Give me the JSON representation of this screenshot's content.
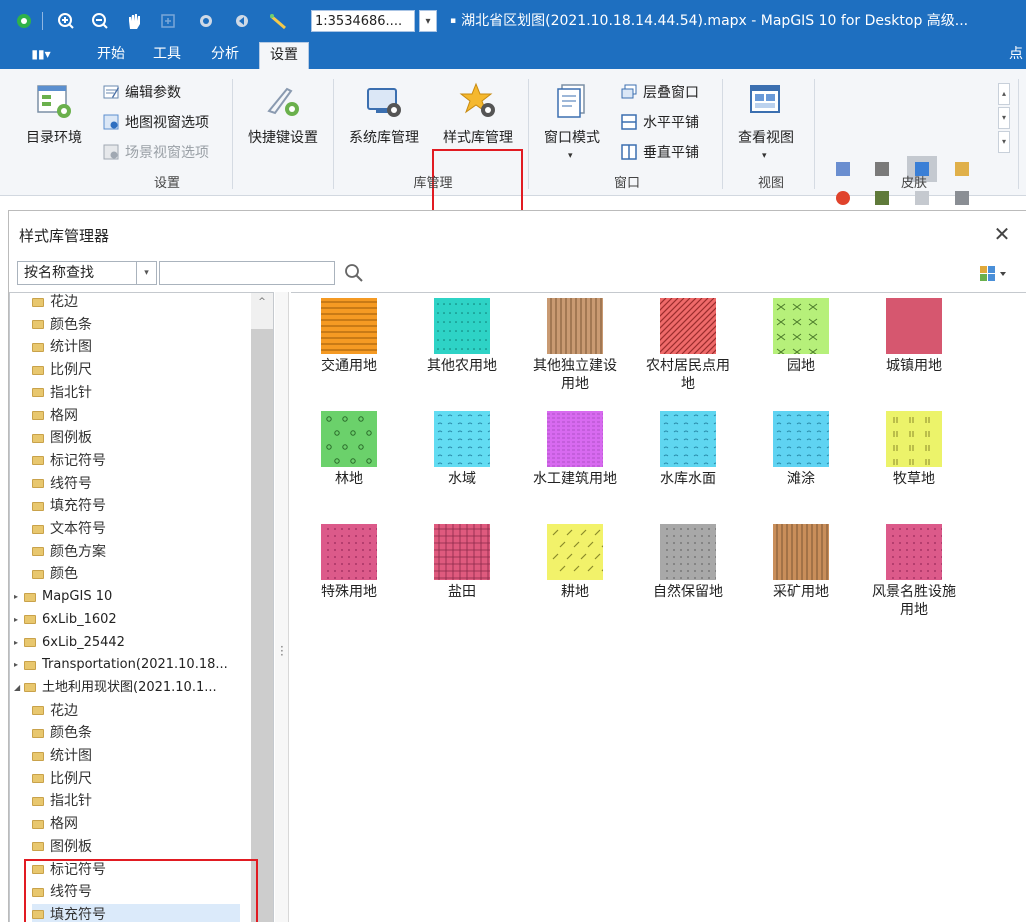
{
  "toolbar": {
    "scale_value": "1:3534686....",
    "window_title": "湖北省区划图(2021.10.18.14.44.54).mapx - MapGIS 10 for Desktop 高级..."
  },
  "tabs": [
    {
      "label": "开始"
    },
    {
      "label": "工具"
    },
    {
      "label": "分析"
    },
    {
      "label": "设置",
      "active": true
    },
    {
      "label": "点"
    }
  ],
  "ribbon": {
    "settings_group": {
      "label": "设置",
      "catalog_env": "目录环境",
      "edit_params": "编辑参数",
      "map_view_options": "地图视窗选项",
      "scene_view_options": "场景视窗选项",
      "shortcut_settings": "快捷键设置"
    },
    "library_group": {
      "label": "库管理",
      "system_lib": "系统库管理",
      "style_lib": "样式库管理"
    },
    "window_group": {
      "label": "窗口",
      "window_mode": "窗口模式",
      "cascade": "层叠窗口",
      "tile_horizontal": "水平平铺",
      "tile_vertical": "垂直平铺"
    },
    "view_group": {
      "label": "视图",
      "view_button": "查看视图"
    },
    "skin_group": {
      "label": "皮肤"
    }
  },
  "dialog": {
    "title": "样式库管理器",
    "search_mode": "按名称查找",
    "search_placeholder": ""
  },
  "tree": [
    {
      "label": "花边",
      "kind": "folder"
    },
    {
      "label": "颜色条",
      "kind": "folder"
    },
    {
      "label": "统计图",
      "kind": "folder"
    },
    {
      "label": "比例尺",
      "kind": "folder"
    },
    {
      "label": "指北针",
      "kind": "folder"
    },
    {
      "label": "格网",
      "kind": "folder"
    },
    {
      "label": "图例板",
      "kind": "folder"
    },
    {
      "label": "标记符号",
      "kind": "folder"
    },
    {
      "label": "线符号",
      "kind": "folder"
    },
    {
      "label": "填充符号",
      "kind": "folder"
    },
    {
      "label": "文本符号",
      "kind": "folder"
    },
    {
      "label": "颜色方案",
      "kind": "folder"
    },
    {
      "label": "颜色",
      "kind": "folder"
    },
    {
      "label": "MapGIS 10",
      "kind": "root"
    },
    {
      "label": "6xLib_1602",
      "kind": "root"
    },
    {
      "label": "6xLib_25442",
      "kind": "root"
    },
    {
      "label": "Transportation(2021.10.18...",
      "kind": "root"
    },
    {
      "label": "土地利用现状图(2021.10.1...",
      "kind": "root-open"
    },
    {
      "label": "花边",
      "kind": "folder"
    },
    {
      "label": "颜色条",
      "kind": "folder"
    },
    {
      "label": "统计图",
      "kind": "folder"
    },
    {
      "label": "比例尺",
      "kind": "folder"
    },
    {
      "label": "指北针",
      "kind": "folder"
    },
    {
      "label": "格网",
      "kind": "folder"
    },
    {
      "label": "图例板",
      "kind": "folder"
    },
    {
      "label": "标记符号",
      "kind": "folder"
    },
    {
      "label": "线符号",
      "kind": "folder"
    },
    {
      "label": "填充符号",
      "kind": "folder",
      "selected": true
    }
  ],
  "symbols": [
    {
      "label": "交通用地",
      "pattern": "h-stripes",
      "color": "#f59a23",
      "line": "#9a5a08"
    },
    {
      "label": "其他农用地",
      "pattern": "dots",
      "color": "#2ed3c6",
      "line": "#0e7a72"
    },
    {
      "label": "其他独立建设用地",
      "pattern": "v-stripes",
      "color": "#c99a72",
      "line": "#7a5534"
    },
    {
      "label": "农村居民点用地",
      "pattern": "diag",
      "color": "#ef6a6a",
      "line": "#9a2d2d"
    },
    {
      "label": "园地",
      "pattern": "scissors",
      "color": "#b6f07a",
      "line": "#4b7a2a"
    },
    {
      "label": "城镇用地",
      "pattern": "solid",
      "color": "#d6576f",
      "line": "#a83a52"
    },
    {
      "label": "林地",
      "pattern": "circles",
      "color": "#6bd16b",
      "line": "#2a6a2a"
    },
    {
      "label": "水域",
      "pattern": "waves",
      "color": "#62dcf2",
      "line": "#2a8aa8"
    },
    {
      "label": "水工建筑用地",
      "pattern": "fine-h",
      "color": "#d86af0",
      "line": "#8a3aa0"
    },
    {
      "label": "水库水面",
      "pattern": "waves",
      "color": "#5fd6f0",
      "line": "#2a8aa8"
    },
    {
      "label": "滩涂",
      "pattern": "waves",
      "color": "#5fd3f2",
      "line": "#2a8aa8"
    },
    {
      "label": "牧草地",
      "pattern": "ticks",
      "color": "#ecf36a",
      "line": "#8a8a2a"
    },
    {
      "label": "特殊用地",
      "pattern": "fine-dots",
      "color": "#dc5a8a",
      "line": "#9a2a5a"
    },
    {
      "label": "盐田",
      "pattern": "grid",
      "color": "#df5a7e",
      "line": "#8a2a4a"
    },
    {
      "label": "耕地",
      "pattern": "dashes",
      "color": "#f2f26a",
      "line": "#8a8a2a"
    },
    {
      "label": "自然保留地",
      "pattern": "fine-dots",
      "color": "#a8a8a8",
      "line": "#6a6a6a"
    },
    {
      "label": "采矿用地",
      "pattern": "v-stripes",
      "color": "#c98e5a",
      "line": "#7a5534"
    },
    {
      "label": "风景名胜设施用地",
      "pattern": "fine-dots",
      "color": "#dc5a8a",
      "line": "#9a2a5a"
    }
  ],
  "colors": {
    "titlebar": "#1e6fc0",
    "highlight": "#e11b22"
  }
}
